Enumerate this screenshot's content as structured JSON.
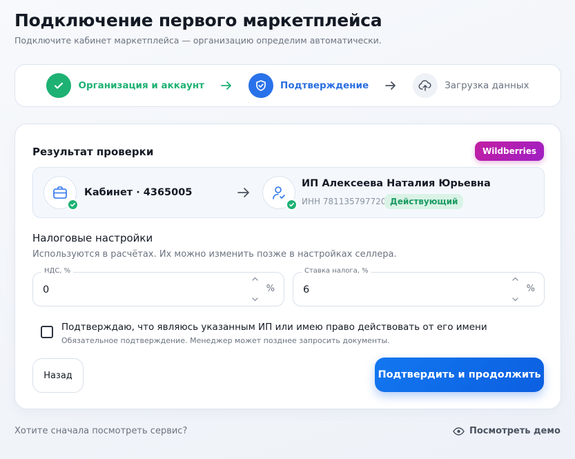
{
  "header": {
    "title": "Подключение первого маркетплейса",
    "subtitle": "Подключите кабинет маркетплейса — организацию определим автоматически."
  },
  "stepper": {
    "steps": [
      {
        "label": "Организация и аккаунт",
        "state": "done",
        "icon": "check-icon"
      },
      {
        "label": "Подтверждение",
        "state": "active",
        "icon": "shield-icon"
      },
      {
        "label": "Загрузка данных",
        "state": "pending",
        "icon": "cloud-upload-icon"
      }
    ]
  },
  "result": {
    "title": "Результат проверки",
    "marketplace": "Wildberries",
    "cabinet": "Кабинет · 4365005",
    "org_name": "ИП Алексеева Наталия Юрьевна",
    "inn": "ИНН 781135797720",
    "status": "Действующий"
  },
  "tax": {
    "title": "Налоговые настройки",
    "description": "Используются в расчётах. Их можно изменить позже в настройках селлера.",
    "vat": {
      "label": "НДС, %",
      "value": "0",
      "unit": "%"
    },
    "rate": {
      "label": "Ставка налога, %",
      "value": "6",
      "unit": "%"
    }
  },
  "confirm": {
    "label": "Подтверждаю, что являюсь указанным ИП или имею право действовать от его имени",
    "note": "Обязательное подтверждение. Менеджер может позднее запросить документы.",
    "checked": false
  },
  "actions": {
    "back": "Назад",
    "primary": "Подтвердить и продолжить"
  },
  "footer": {
    "question": "Хотите сначала посмотреть сервис?",
    "demo": "Посмотреть демо"
  },
  "colors": {
    "success": "#1db173",
    "accent": "#2a72ea",
    "marketplace": "#c21fa2"
  }
}
